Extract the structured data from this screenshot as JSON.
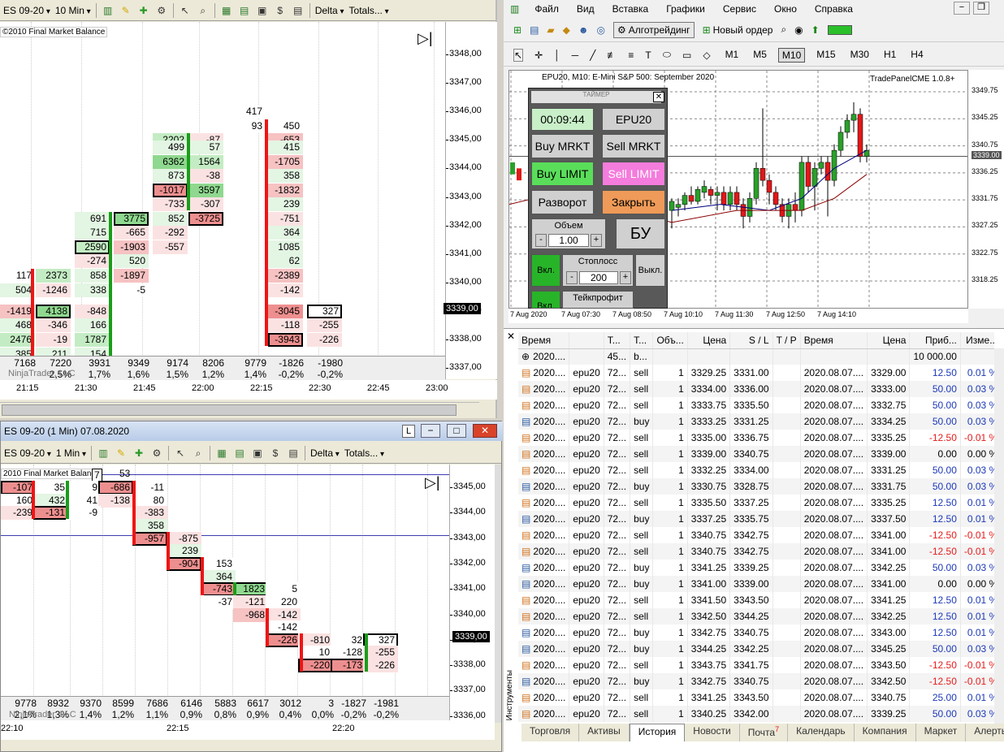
{
  "left_top": {
    "toolbar": {
      "instrument": "ES 09-20",
      "period": "10 Min",
      "delta": "Delta",
      "totals": "Totals..."
    },
    "copyright": "©2010 Final Market Balance",
    "price_label": "3339,00",
    "y_labels": [
      "3348,00",
      "3347,00",
      "3346,00",
      "3345,00",
      "3344,00",
      "3343,00",
      "3342,00",
      "3341,00",
      "3340,00",
      "3339,00",
      "3338,00",
      "3337,00"
    ],
    "x_labels": [
      "21:15",
      "21:30",
      "21:45",
      "22:00",
      "22:15",
      "22:30",
      "22:45",
      "23:00"
    ],
    "totals": [
      "7168",
      "7220",
      "3931",
      "9349",
      "9174",
      "8206",
      "9779",
      "-1826",
      "-1980"
    ],
    "pct": [
      "2,5%",
      "1,7%",
      "1,6%",
      "1,5%",
      "1,2%",
      "1,4%",
      "-0,2%",
      "-0,2%"
    ],
    "watermark": "NinjaTrader, LLC",
    "cells": [
      [
        "417",
        "3346,00",
        "c6",
        "#fff",
        ""
      ],
      [
        "93",
        "3345,50",
        "c6",
        "#fff",
        ""
      ],
      [
        "450",
        "3345,50",
        "c7",
        "#fff",
        ""
      ],
      [
        "2202",
        "3345,00",
        "c4",
        "g2",
        ""
      ],
      [
        "-87",
        "3345,00",
        "c5",
        "r1",
        ""
      ],
      [
        "-653",
        "3345,00",
        "c7",
        "r2",
        ""
      ],
      [
        "499",
        "3344,75",
        "c4",
        "g1",
        ""
      ],
      [
        "57",
        "3344,75",
        "c5",
        "g1",
        ""
      ],
      [
        "415",
        "3344,75",
        "c7",
        "g1",
        ""
      ],
      [
        "6362",
        "3344,25",
        "c4",
        "g3",
        ""
      ],
      [
        "1564",
        "3344,25",
        "c5",
        "g2",
        ""
      ],
      [
        "-1705",
        "3344,25",
        "c7",
        "r2",
        ""
      ],
      [
        "873",
        "3343,75",
        "c4",
        "g1",
        ""
      ],
      [
        "-38",
        "3343,75",
        "c5",
        "r1",
        ""
      ],
      [
        "358",
        "3343,75",
        "c7",
        "g1",
        ""
      ],
      [
        "-1017",
        "3343,25",
        "c4",
        "r3",
        "box"
      ],
      [
        "3597",
        "3343,25",
        "c5",
        "g3",
        ""
      ],
      [
        "-1832",
        "3343,25",
        "c7",
        "r2",
        ""
      ],
      [
        "-733",
        "3342,75",
        "c4",
        "r1",
        ""
      ],
      [
        "-307",
        "3342,75",
        "c5",
        "r1",
        ""
      ],
      [
        "239",
        "3342,75",
        "c7",
        "g1",
        ""
      ],
      [
        "691",
        "3342,25",
        "c2",
        "g1",
        ""
      ],
      [
        "3775",
        "3342,25",
        "c3",
        "g3",
        "box"
      ],
      [
        "852",
        "3342,25",
        "c4",
        "g1",
        ""
      ],
      [
        "-3725",
        "3342,25",
        "c5",
        "r3",
        "box"
      ],
      [
        "-751",
        "3342,25",
        "c7",
        "r1",
        ""
      ],
      [
        "715",
        "3341,75",
        "c2",
        "g1",
        ""
      ],
      [
        "-665",
        "3341,75",
        "c3",
        "r1",
        ""
      ],
      [
        "-292",
        "3341,75",
        "c4",
        "r1",
        ""
      ],
      [
        "364",
        "3341,75",
        "c7",
        "g1",
        ""
      ],
      [
        "2590",
        "3341,25",
        "c2",
        "g2",
        "box"
      ],
      [
        "-1903",
        "3341,25",
        "c3",
        "r2",
        ""
      ],
      [
        "-557",
        "3341,25",
        "c4",
        "r1",
        ""
      ],
      [
        "1085",
        "3341,25",
        "c7",
        "g1",
        ""
      ],
      [
        "-274",
        "3340,75",
        "c2",
        "r1",
        ""
      ],
      [
        "520",
        "3340,75",
        "c3",
        "g1",
        ""
      ],
      [
        "62",
        "3340,75",
        "c7",
        "g1",
        ""
      ],
      [
        "117",
        "3340,25",
        "c0",
        "#fff",
        ""
      ],
      [
        "2373",
        "3340,25",
        "c1",
        "g2",
        ""
      ],
      [
        "858",
        "3340,25",
        "c2",
        "g1",
        ""
      ],
      [
        "-1897",
        "3340,25",
        "c3",
        "r2",
        ""
      ],
      [
        "-2389",
        "3340,25",
        "c7",
        "r2",
        ""
      ],
      [
        "504",
        "3339,75",
        "c0",
        "g1",
        ""
      ],
      [
        "-1246",
        "3339,75",
        "c1",
        "r1",
        ""
      ],
      [
        "338",
        "3339,75",
        "c2",
        "g1",
        ""
      ],
      [
        "-5",
        "3339,75",
        "c3",
        "#fff",
        ""
      ],
      [
        "-142",
        "3339,75",
        "c7",
        "r1",
        ""
      ],
      [
        "-1419",
        "3339,00",
        "c0",
        "r2",
        ""
      ],
      [
        "4138",
        "3339,00",
        "c1",
        "g3",
        "box"
      ],
      [
        "-848",
        "3339,00",
        "c2",
        "r1",
        ""
      ],
      [
        "-3045",
        "3339,00",
        "c7",
        "r3",
        ""
      ],
      [
        "327",
        "3339,00",
        "c8",
        "#fff",
        "box"
      ],
      [
        "468",
        "3338,50",
        "c0",
        "g1",
        ""
      ],
      [
        "-346",
        "3338,50",
        "c1",
        "r1",
        ""
      ],
      [
        "166",
        "3338,50",
        "c2",
        "g1",
        ""
      ],
      [
        "-118",
        "3338,50",
        "c7",
        "r1",
        ""
      ],
      [
        "-255",
        "3338,50",
        "c8",
        "r1",
        ""
      ],
      [
        "2476",
        "3338,00",
        "c0",
        "g2",
        ""
      ],
      [
        "-19",
        "3338,00",
        "c1",
        "r1",
        ""
      ],
      [
        "1787",
        "3338,00",
        "c2",
        "g2",
        ""
      ],
      [
        "-3943",
        "3338,00",
        "c7",
        "r3",
        "box"
      ],
      [
        "-226",
        "3338,00",
        "c8",
        "r1",
        ""
      ],
      [
        "385",
        "3337,50",
        "c0",
        "g1",
        ""
      ],
      [
        "211",
        "3337,50",
        "c1",
        "g1",
        ""
      ],
      [
        "154",
        "3337,50",
        "c2",
        "g1",
        ""
      ]
    ]
  },
  "left_bottom": {
    "title": "ES 09-20 (1 Min)  07.08.2020",
    "toolbar": {
      "instrument": "ES 09-20",
      "period": "1 Min",
      "delta": "Delta",
      "totals": "Totals..."
    },
    "copyright": "2010 Final Market Balance",
    "price_label": "3339,00",
    "y_labels": [
      "3345,00",
      "3344,00",
      "3343,00",
      "3342,00",
      "3341,00",
      "3340,00",
      "3339,00",
      "3338,00",
      "3337,00",
      "3336,00"
    ],
    "x_labels": [
      "22:10",
      "22:15",
      "22:20"
    ],
    "totals": [
      "9778",
      "8932",
      "9370",
      "8599",
      "7686",
      "6146",
      "5883",
      "6617",
      "3012",
      "3",
      "-1827",
      "-1981"
    ],
    "pct": [
      "2,1%",
      "1,3%",
      "1,4%",
      "1,2%",
      "1,1%",
      "0,9%",
      "0,8%",
      "0,9%",
      "0,4%",
      "0,0%",
      "-0,2%",
      "-0,2%"
    ],
    "watermark": "NinjaTrader, LLC",
    "top_vals": [
      "7",
      "53"
    ],
    "cells": [
      [
        "-107",
        "3345,00",
        "c0",
        "r3",
        "box"
      ],
      [
        "35",
        "3345,00",
        "c1",
        "#fff",
        ""
      ],
      [
        "9",
        "3345,00",
        "c2",
        "#fff",
        ""
      ],
      [
        "-686",
        "3345,00",
        "c3",
        "r3",
        "box"
      ],
      [
        "-11",
        "3345,00",
        "c4",
        "#fff",
        ""
      ],
      [
        "160",
        "3344,50",
        "c0",
        "#fff",
        ""
      ],
      [
        "432",
        "3344,50",
        "c1",
        "g1",
        ""
      ],
      [
        "41",
        "3344,50",
        "c2",
        "#fff",
        ""
      ],
      [
        "-138",
        "3344,50",
        "c3",
        "r1",
        ""
      ],
      [
        "80",
        "3344,50",
        "c4",
        "#fff",
        ""
      ],
      [
        "-239",
        "3344,00",
        "c0",
        "r1",
        ""
      ],
      [
        "-131",
        "3344,00",
        "c1",
        "r3",
        "box"
      ],
      [
        "-9",
        "3344,00",
        "c2",
        "#fff",
        ""
      ],
      [
        "-383",
        "3344,00",
        "c4",
        "r1",
        ""
      ],
      [
        "358",
        "3343,50",
        "c4",
        "g1",
        ""
      ],
      [
        "-957",
        "3343,00",
        "c4",
        "r3",
        "box"
      ],
      [
        "-875",
        "3343,00",
        "c5",
        "r1",
        ""
      ],
      [
        "239",
        "3342,50",
        "c5",
        "g1",
        ""
      ],
      [
        "-904",
        "3342,00",
        "c5",
        "r3",
        "box"
      ],
      [
        "153",
        "3342,00",
        "c6",
        "#fff",
        ""
      ],
      [
        "364",
        "3341,50",
        "c6",
        "g1",
        ""
      ],
      [
        "-743",
        "3341,00",
        "c6",
        "r3",
        "box"
      ],
      [
        "1823",
        "3341,00",
        "c7",
        "g3",
        "box"
      ],
      [
        "5",
        "3341,00",
        "c8",
        "#fff",
        ""
      ],
      [
        "-37",
        "3340,50",
        "c6",
        "#fff",
        ""
      ],
      [
        "-121",
        "3340,50",
        "c7",
        "r1",
        ""
      ],
      [
        "220",
        "3340,50",
        "c8",
        "#fff",
        ""
      ],
      [
        "-968",
        "3340,00",
        "c7",
        "r2",
        ""
      ],
      [
        "-142",
        "3340,00",
        "c8",
        "r1",
        ""
      ],
      [
        "-142",
        "3339,50",
        "c8",
        "#fff",
        ""
      ],
      [
        "-226",
        "3339,00",
        "c8",
        "r3",
        "box"
      ],
      [
        "-810",
        "3339,00",
        "c9",
        "r1",
        ""
      ],
      [
        "32",
        "3339,00",
        "c10",
        "#fff",
        ""
      ],
      [
        "327",
        "3339,00",
        "c11",
        "#fff",
        "box"
      ],
      [
        "10",
        "3338,50",
        "c9",
        "#fff",
        ""
      ],
      [
        "-128",
        "3338,50",
        "c10",
        "#fff",
        ""
      ],
      [
        "-255",
        "3338,50",
        "c11",
        "r1",
        ""
      ],
      [
        "-220",
        "3338,00",
        "c9",
        "r3",
        "box"
      ],
      [
        "-173",
        "3338,00",
        "c10",
        "r3",
        "box"
      ],
      [
        "-226",
        "3338,00",
        "c11",
        "r1",
        ""
      ]
    ]
  },
  "mt": {
    "menu": [
      "Файл",
      "Вид",
      "Вставка",
      "Графики",
      "Сервис",
      "Окно",
      "Справка"
    ],
    "algo": "Алготрейдинг",
    "neworder": "Новый ордер",
    "timeframes": [
      "M1",
      "M5",
      "M10",
      "M15",
      "M30",
      "H1",
      "H4"
    ],
    "chart_title": "EPU20, M10:  E-Mini S&P 500: September 2020",
    "tradepanel": "TradePanelCME 1.0.8+",
    "y_labels": [
      "3349.75",
      "3345.25",
      "3340.75",
      "3339.00",
      "3336.25",
      "3331.75",
      "3327.25",
      "3322.75",
      "3318.25"
    ],
    "x_labels": [
      "7 Aug 2020",
      "7 Aug 07:30",
      "7 Aug 08:50",
      "7 Aug 10:10",
      "7 Aug 11:30",
      "7 Aug 12:50",
      "7 Aug 14:10"
    ],
    "panel": {
      "timer_title": "ТАЙМЕР",
      "timer": "00:09:44",
      "symbol": "EPU20",
      "buy_mrkt": "Buy MRKT",
      "sell_mrkt": "Sell MRKT",
      "buy_limit": "Buy LIMIT",
      "sell_limit": "Sell LIMIT",
      "reverse": "Разворот",
      "close": "Закрыть",
      "volume_label": "Объем",
      "volume": "1.00",
      "bu": "БУ",
      "on": "Вкл.",
      "off": "Выкл.",
      "stoploss": "Стоплосс",
      "sl_value": "200",
      "takeprofit": "Тейкпрофит",
      "minus": "-",
      "plus": "+"
    },
    "history_headers": [
      "Время",
      "",
      "Т...",
      "Т...",
      "Объ...",
      "Цена",
      "S / L",
      "T / P",
      "Время",
      "Цена",
      "Приб...",
      "Изме..."
    ],
    "balance_row": [
      "2020....",
      "",
      "45...",
      "b...",
      "",
      "",
      "",
      "",
      "",
      "",
      "10 000.00",
      ""
    ],
    "rows": [
      [
        "2020....",
        "epu20",
        "72...",
        "sell",
        "1",
        "3329.25",
        "3331.00",
        "",
        "2020.08.07....",
        "3329.00",
        "12.50",
        "0.01 %"
      ],
      [
        "2020....",
        "epu20",
        "72...",
        "sell",
        "1",
        "3334.00",
        "3336.00",
        "",
        "2020.08.07....",
        "3333.00",
        "50.00",
        "0.03 %"
      ],
      [
        "2020....",
        "epu20",
        "72...",
        "sell",
        "1",
        "3333.75",
        "3335.50",
        "",
        "2020.08.07....",
        "3332.75",
        "50.00",
        "0.03 %"
      ],
      [
        "2020....",
        "epu20",
        "72...",
        "buy",
        "1",
        "3333.25",
        "3331.25",
        "",
        "2020.08.07....",
        "3334.25",
        "50.00",
        "0.03 %"
      ],
      [
        "2020....",
        "epu20",
        "72...",
        "sell",
        "1",
        "3335.00",
        "3336.75",
        "",
        "2020.08.07....",
        "3335.25",
        "-12.50",
        "-0.01 %"
      ],
      [
        "2020....",
        "epu20",
        "72...",
        "sell",
        "1",
        "3339.00",
        "3340.75",
        "",
        "2020.08.07....",
        "3339.00",
        "0.00",
        "0.00 %"
      ],
      [
        "2020....",
        "epu20",
        "72...",
        "sell",
        "1",
        "3332.25",
        "3334.00",
        "",
        "2020.08.07....",
        "3331.25",
        "50.00",
        "0.03 %"
      ],
      [
        "2020....",
        "epu20",
        "72...",
        "buy",
        "1",
        "3330.75",
        "3328.75",
        "",
        "2020.08.07....",
        "3331.75",
        "50.00",
        "0.03 %"
      ],
      [
        "2020....",
        "epu20",
        "72...",
        "sell",
        "1",
        "3335.50",
        "3337.25",
        "",
        "2020.08.07....",
        "3335.25",
        "12.50",
        "0.01 %"
      ],
      [
        "2020....",
        "epu20",
        "72...",
        "buy",
        "1",
        "3337.25",
        "3335.75",
        "",
        "2020.08.07....",
        "3337.50",
        "12.50",
        "0.01 %"
      ],
      [
        "2020....",
        "epu20",
        "72...",
        "sell",
        "1",
        "3340.75",
        "3342.75",
        "",
        "2020.08.07....",
        "3341.00",
        "-12.50",
        "-0.01 %"
      ],
      [
        "2020....",
        "epu20",
        "72...",
        "sell",
        "1",
        "3340.75",
        "3342.75",
        "",
        "2020.08.07....",
        "3341.00",
        "-12.50",
        "-0.01 %"
      ],
      [
        "2020....",
        "epu20",
        "72...",
        "buy",
        "1",
        "3341.25",
        "3339.25",
        "",
        "2020.08.07....",
        "3342.25",
        "50.00",
        "0.03 %"
      ],
      [
        "2020....",
        "epu20",
        "72...",
        "buy",
        "1",
        "3341.00",
        "3339.00",
        "",
        "2020.08.07....",
        "3341.00",
        "0.00",
        "0.00 %"
      ],
      [
        "2020....",
        "epu20",
        "72...",
        "sell",
        "1",
        "3341.50",
        "3343.50",
        "",
        "2020.08.07....",
        "3341.25",
        "12.50",
        "0.01 %"
      ],
      [
        "2020....",
        "epu20",
        "72...",
        "sell",
        "1",
        "3342.50",
        "3344.25",
        "",
        "2020.08.07....",
        "3342.25",
        "12.50",
        "0.01 %"
      ],
      [
        "2020....",
        "epu20",
        "72...",
        "buy",
        "1",
        "3342.75",
        "3340.75",
        "",
        "2020.08.07....",
        "3343.00",
        "12.50",
        "0.01 %"
      ],
      [
        "2020....",
        "epu20",
        "72...",
        "buy",
        "1",
        "3344.25",
        "3342.25",
        "",
        "2020.08.07....",
        "3345.25",
        "50.00",
        "0.03 %"
      ],
      [
        "2020....",
        "epu20",
        "72...",
        "sell",
        "1",
        "3343.75",
        "3341.75",
        "",
        "2020.08.07....",
        "3343.50",
        "-12.50",
        "-0.01 %"
      ],
      [
        "2020....",
        "epu20",
        "72...",
        "buy",
        "1",
        "3342.75",
        "3340.75",
        "",
        "2020.08.07....",
        "3342.50",
        "-12.50",
        "-0.01 %"
      ],
      [
        "2020....",
        "epu20",
        "72...",
        "sell",
        "1",
        "3341.25",
        "3343.50",
        "",
        "2020.08.07....",
        "3340.75",
        "25.00",
        "0.01 %"
      ],
      [
        "2020....",
        "epu20",
        "72...",
        "sell",
        "1",
        "3340.25",
        "3342.00",
        "",
        "2020.08.07....",
        "3339.25",
        "50.00",
        "0.03 %"
      ]
    ],
    "tabs": [
      "Торговля",
      "Активы",
      "История",
      "Новости",
      "Почта",
      "Календарь",
      "Компания",
      "Маркет",
      "Алерты"
    ],
    "mail_count": "7",
    "side_label": "Инструменты",
    "colors": {
      "profit": "#1c38b8",
      "loss": "#e51a1a",
      "green_bar": "#1a9e1a",
      "red_bar": "#ef1515"
    }
  }
}
